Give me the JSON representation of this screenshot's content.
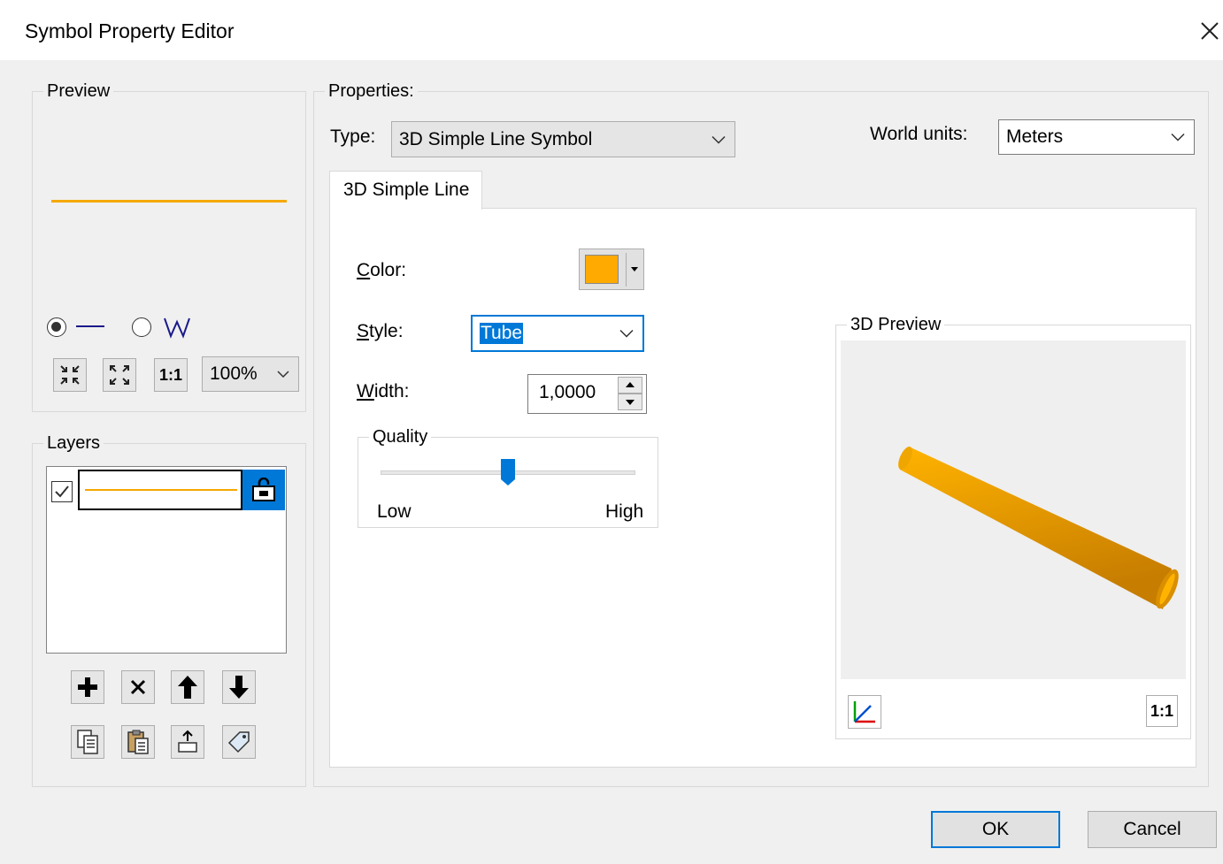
{
  "window": {
    "title": "Symbol Property Editor",
    "close_icon": "close-icon"
  },
  "preview": {
    "group_label": "Preview",
    "line_color": "#f5a800",
    "radio_line_selected": true,
    "zoom_value": "100%",
    "one_to_one_label": "1:1"
  },
  "layers": {
    "group_label": "Layers",
    "items": [
      {
        "checked": true,
        "line_color": "#f5a800"
      }
    ]
  },
  "properties": {
    "group_label": "Properties:",
    "type_label": "Type:",
    "type_value": "3D Simple Line Symbol",
    "world_units_label": "World units:",
    "world_units_value": "Meters",
    "tab_label": "3D Simple Line",
    "color_label": "Color:",
    "color_value": "#ffaa00",
    "style_label": "Style:",
    "style_value": "Tube",
    "width_label": "Width:",
    "width_value": "1,0000",
    "quality": {
      "group_label": "Quality",
      "low_label": "Low",
      "high_label": "High",
      "value": 0.5
    }
  },
  "preview3d": {
    "group_label": "3D Preview",
    "one_to_one_label": "1:1",
    "tube_color": "#e8a300"
  },
  "footer": {
    "ok_label": "OK",
    "cancel_label": "Cancel"
  }
}
